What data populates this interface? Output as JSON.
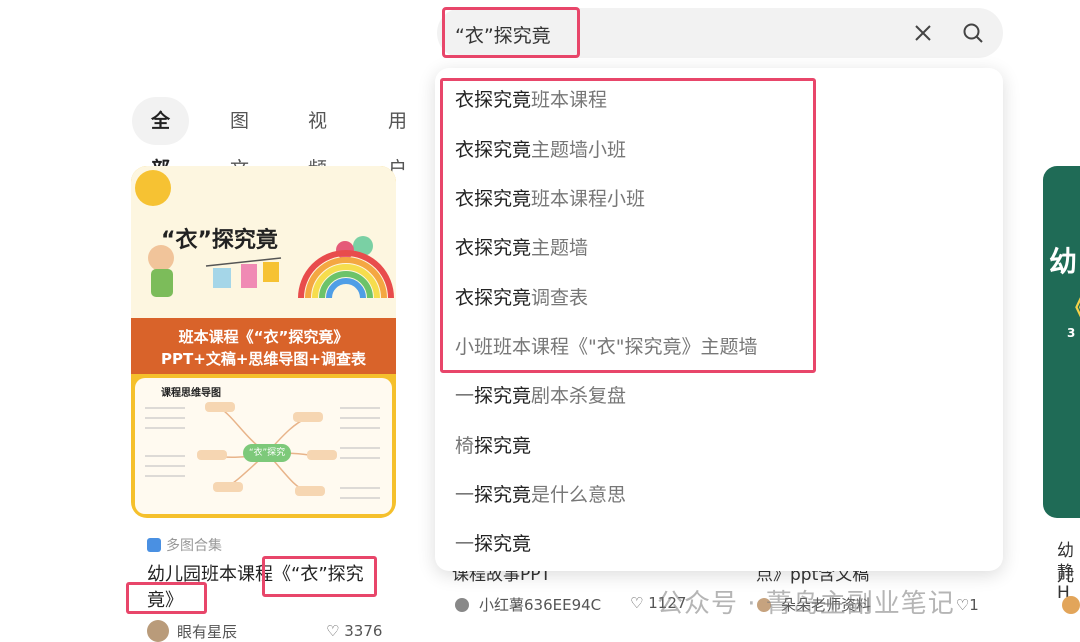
{
  "search": {
    "query": "“衣”探究竟"
  },
  "tabs": [
    "全部",
    "图文",
    "视频",
    "用户"
  ],
  "suggestions": [
    {
      "bold": "衣探究竟",
      "rest": "班本课程"
    },
    {
      "bold": "衣探究竟",
      "rest": "主题墙小班"
    },
    {
      "bold": "衣探究竟",
      "rest": "班本课程小班"
    },
    {
      "bold": "衣探究竟",
      "rest": "主题墙"
    },
    {
      "bold": "衣探究竟",
      "rest": "调查表"
    },
    {
      "plain": "小班班本课程《\"衣\"探究竟》主题墙"
    },
    {
      "pre": "一",
      "bold": "探究竟",
      "rest": "剧本杀复盘"
    },
    {
      "pre": "椅",
      "bold": "探究竟",
      "rest": ""
    },
    {
      "pre": "一",
      "bold": "探究竟",
      "rest": "是什么意思"
    },
    {
      "pre": "一",
      "bold": "探究竟",
      "rest": ""
    }
  ],
  "card_left": {
    "cover_title": "“衣”探究竟",
    "cover_band_line1": "班本课程《“衣”探究竟》",
    "cover_band_line2": "PPT+文稿+思维导图+调查表",
    "map_title": "课程思维导图",
    "map_center": "“衣”探究",
    "tag": "多图合集",
    "title": "幼儿园班本课程《“衣”探究竟》",
    "author": "眼有星辰",
    "likes": "3376"
  },
  "card_mid": {
    "title_a": "课程故事PPT",
    "title_b": "点》ppt含文稿",
    "author_a": "小红薯636EE94C",
    "likes_a": "1127",
    "author_b": "朵朵老师资料",
    "likes_b": "1"
  },
  "card_right": {
    "cover_a": "幼",
    "cover_b": "《",
    "cover_c": "3",
    "title_a": "幼儿",
    "title_b": "静H"
  },
  "watermark": "公众号 · 菁岛主副业笔记",
  "colors": {
    "highlight": "#e8466a",
    "cover_band": "#d9632a",
    "right_cover": "#1f6b56"
  }
}
